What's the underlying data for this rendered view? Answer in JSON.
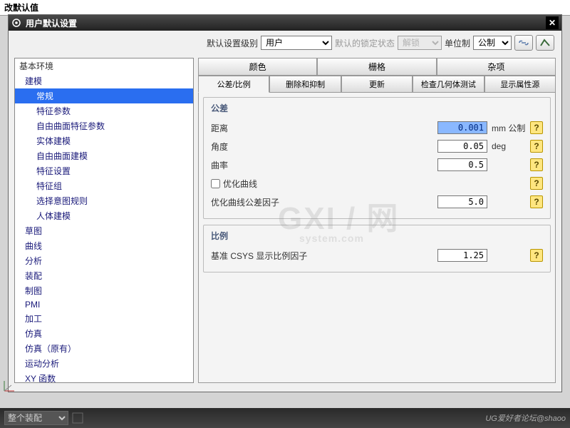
{
  "window_title": "改默认值",
  "dialog_title": "用户默认设置",
  "top": {
    "level_label": "默认设置级别",
    "level_value": "用户",
    "lock_label": "默认的锁定状态",
    "lock_value": "解锁",
    "unit_label": "单位制",
    "unit_value": "公制"
  },
  "tree": {
    "root": "基本环境",
    "modeling": "建模",
    "items": [
      "常规",
      "特征参数",
      "自由曲面特征参数",
      "实体建模",
      "自由曲面建模",
      "特征设置",
      "特征组",
      "选择意图规则",
      "人体建模"
    ],
    "rest": [
      "草图",
      "曲线",
      "分析",
      "装配",
      "制图",
      "PMI",
      "加工",
      "仿真",
      "仿真（原有）",
      "运动分析",
      "XY 函数"
    ]
  },
  "tabs1": [
    "颜色",
    "栅格",
    "杂项"
  ],
  "tabs2": [
    "公差/比例",
    "删除和抑制",
    "更新",
    "检查几何体测试",
    "显示属性源"
  ],
  "tolerance": {
    "title": "公差",
    "distance_label": "距离",
    "distance_value": "0.001",
    "distance_unit": "mm 公制",
    "angle_label": "角度",
    "angle_value": "0.05",
    "angle_unit": "deg",
    "curvature_label": "曲率",
    "curvature_value": "0.5",
    "optimize_label": "优化曲线",
    "factor_label": "优化曲线公差因子",
    "factor_value": "5.0"
  },
  "scale": {
    "title": "比例",
    "csys_label": "基准 CSYS 显示比例因子",
    "csys_value": "1.25"
  },
  "bottom": {
    "assembly": "整个装配",
    "credit": "UG爱好者论坛@shaoo"
  },
  "help_glyph": "?",
  "close_glyph": "✕"
}
